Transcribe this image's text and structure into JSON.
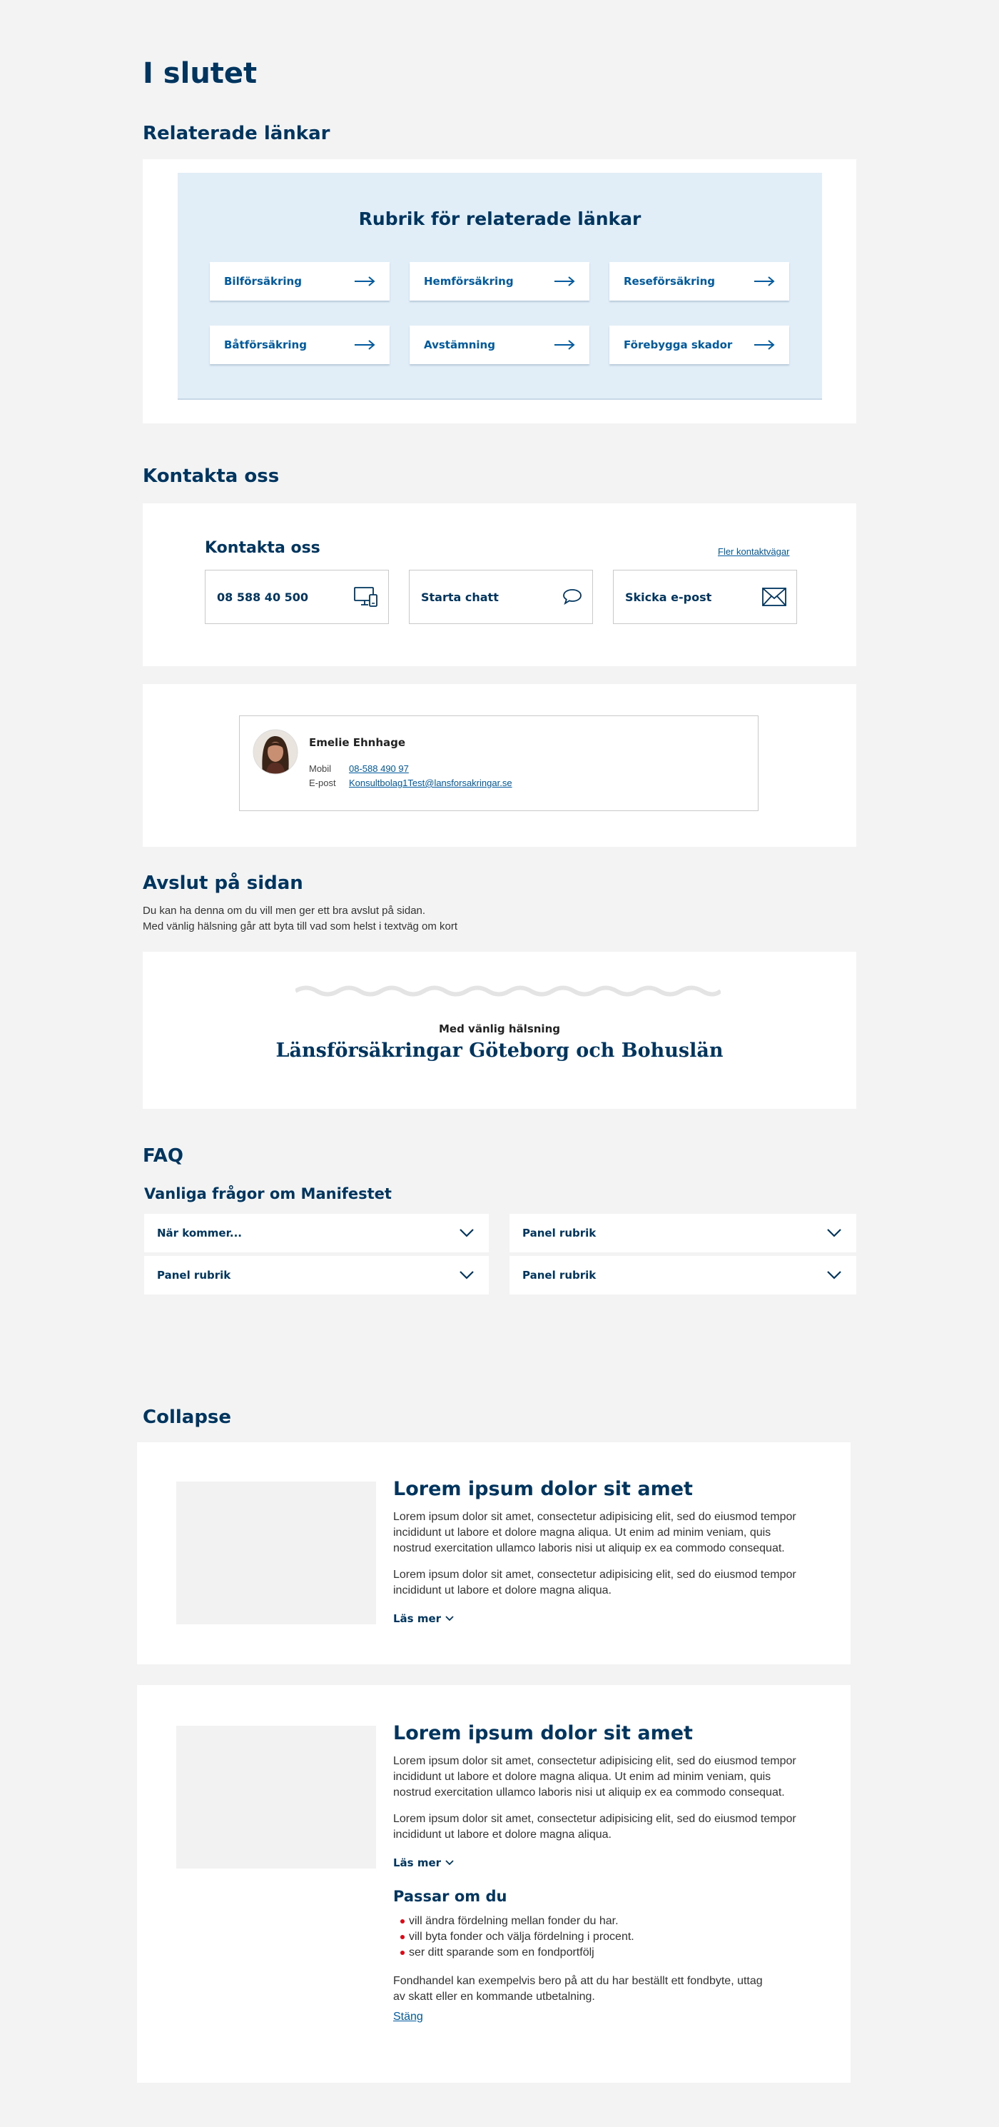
{
  "page": {
    "title": "I slutet"
  },
  "related": {
    "section_heading": "Relaterade länkar",
    "box_title": "Rubrik för relaterade länkar",
    "links": [
      {
        "label": "Bilförsäkring"
      },
      {
        "label": "Hemförsäkring"
      },
      {
        "label": "Reseförsäkring"
      },
      {
        "label": "Båtförsäkring"
      },
      {
        "label": "Avstämning"
      },
      {
        "label": "Förebygga skador"
      }
    ]
  },
  "contact": {
    "section_heading": "Kontakta oss",
    "box_title": "Kontakta oss",
    "more_link": "Fler kontaktvägar",
    "buttons": [
      {
        "label": "08 588 40 500",
        "icon": "computer-phone-icon"
      },
      {
        "label": "Starta chatt",
        "icon": "chat-bubble-icon"
      },
      {
        "label": "Skicka e-post",
        "icon": "envelope-icon"
      }
    ]
  },
  "person": {
    "name": "Emelie Ehnhage",
    "mobile_label": "Mobil",
    "mobile_value": "08-588 490 97",
    "email_label": "E-post",
    "email_value": "Konsultbolag1Test@lansforsakringar.se"
  },
  "closing": {
    "section_heading": "Avslut på sidan",
    "text_line1": "Du kan ha denna om du vill men ger ett bra avslut på sidan.",
    "text_line2": "Med vänlig hälsning går att byta till vad som helst i textväg om kort",
    "greeting": "Med vänlig hälsning",
    "company": "Länsförsäkringar Göteborg och Bohuslän"
  },
  "faq": {
    "section_heading": "FAQ",
    "subheading": "Vanliga frågor om Manifestet",
    "items": [
      {
        "label": "När kommer..."
      },
      {
        "label": "Panel rubrik"
      },
      {
        "label": "Panel rubrik"
      },
      {
        "label": "Panel rubrik"
      }
    ]
  },
  "collapse": {
    "section_heading": "Collapse",
    "cards": [
      {
        "title": "Lorem ipsum dolor sit amet",
        "para1_l1": "Lorem ipsum dolor sit amet, consectetur adipisicing elit, sed do eiusmod tempor",
        "para1_l2": "incididunt ut labore et dolore magna aliqua. Ut enim ad minim veniam, quis",
        "para1_l3": "nostrud exercitation ullamco laboris nisi ut aliquip ex ea commodo consequat.",
        "para2_l1": "Lorem ipsum dolor sit amet, consectetur adipisicing elit, sed do eiusmod tempor",
        "para2_l2": "incididunt ut labore et dolore magna aliqua.",
        "read_more": "Läs mer"
      },
      {
        "title": "Lorem ipsum dolor sit amet",
        "para1_l1": "Lorem ipsum dolor sit amet, consectetur adipisicing elit, sed do eiusmod tempor",
        "para1_l2": "incididunt ut labore et dolore magna aliqua. Ut enim ad minim veniam, quis",
        "para1_l3": "nostrud exercitation ullamco laboris nisi ut aliquip ex ea commodo consequat.",
        "para2_l1": "Lorem ipsum dolor sit amet, consectetur adipisicing elit, sed do eiusmod tempor",
        "para2_l2": "incididunt ut labore et dolore magna aliqua.",
        "read_more": "Läs mer",
        "expanded_title": "Passar om du",
        "bullets": [
          "vill ändra fördelning mellan fonder du har.",
          "vill byta fonder och välja fördelning i procent.",
          "ser ditt sparande som en fondportfölj"
        ],
        "footnote_l1": "Fondhandel kan exempelvis bero på att du har beställt ett fondbyte, uttag",
        "footnote_l2": "av skatt eller en kommande utbetalning.",
        "close_link": "Stäng"
      }
    ]
  },
  "colors": {
    "navy": "#00355f",
    "link_blue": "#005aa0",
    "light_blue_bg": "#e1eef8",
    "page_bg": "#f3f3f3",
    "bullet_red": "#e30613"
  }
}
